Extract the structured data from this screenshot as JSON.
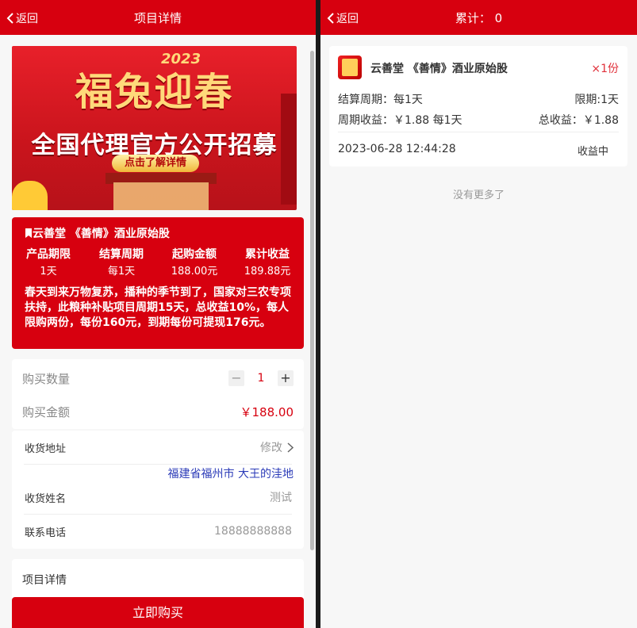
{
  "left": {
    "header": {
      "back_label": "返回",
      "title": "项目详情"
    },
    "banner": {
      "year": "2023",
      "headline": "福兔迎春",
      "subheadline": "全国代理官方公开招募",
      "cta": "点击了解详情"
    },
    "product": {
      "name": "云善堂 《善情》酒业原始股",
      "stats": [
        {
          "label": "产品期限",
          "value": "1天"
        },
        {
          "label": "结算周期",
          "value": "每1天"
        },
        {
          "label": "起购金额",
          "value": "188.00元"
        },
        {
          "label": "累计收益",
          "value": "189.88元"
        }
      ],
      "description": "春天到来万物复苏，播种的季节到了，国家对三农专项扶持，此粮种补贴项目周期15天，总收益10%，每人限购两份，每份160元，到期每份可提现176元。"
    },
    "purchase": {
      "quantity_label": "购买数量",
      "quantity": "1",
      "minus": "−",
      "plus": "+",
      "amount_label": "购买金额",
      "amount": "￥188.00"
    },
    "delivery": {
      "address_label": "收货地址",
      "edit_label": "修改",
      "address": "福建省福州市 大王的洼地",
      "name_label": "收货姓名",
      "name": "测试",
      "phone_label": "联系电话",
      "phone": "18888888888"
    },
    "details_label": "项目详情",
    "buy_button": "立即购买"
  },
  "right": {
    "header": {
      "back_label": "返回",
      "title": "累计： 0"
    },
    "order": {
      "title": "云善堂 《善情》酒业原始股",
      "count": "×1份",
      "cycle": "结算周期：每1天",
      "limit": "限期:1天",
      "period_income": "周期收益：￥1.88 每1天",
      "total_income": "总收益：￥1.88",
      "time": "2023-06-28 12:44:28",
      "status": "收益中"
    },
    "no_more": "没有更多了"
  },
  "colors": {
    "brand_red": "#d7000f",
    "link_blue": "#2b3bb8"
  }
}
